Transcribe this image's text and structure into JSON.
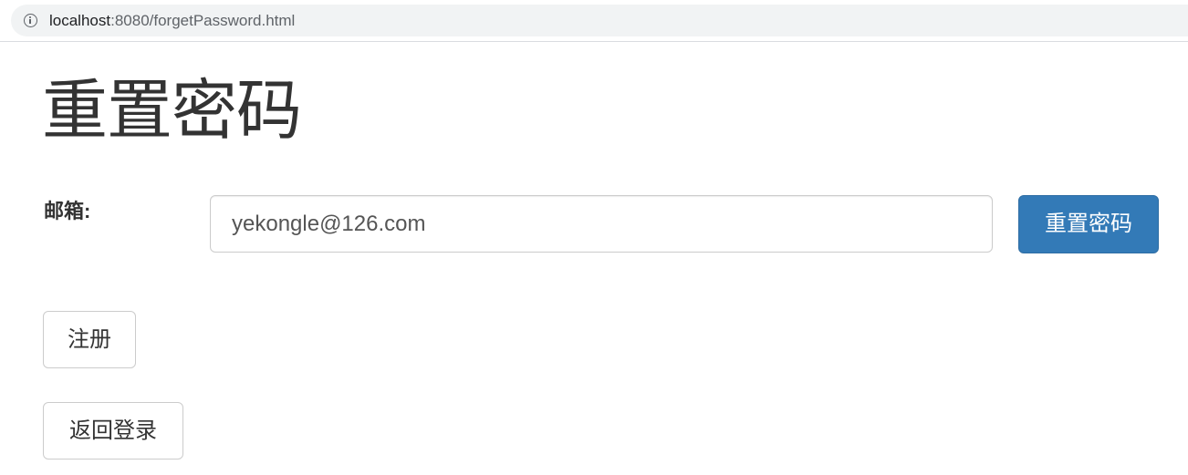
{
  "browser": {
    "url_host": "localhost",
    "url_rest": ":8080/forgetPassword.html",
    "icon": "info-icon"
  },
  "page": {
    "title": "重置密码"
  },
  "form": {
    "email_label": "邮箱:",
    "email_value": "yekongle@126.com",
    "submit_label": "重置密码"
  },
  "links": {
    "register_label": "注册",
    "back_login_label": "返回登录"
  },
  "colors": {
    "primary": "#337ab7",
    "text": "#333333",
    "border": "#cccccc"
  }
}
